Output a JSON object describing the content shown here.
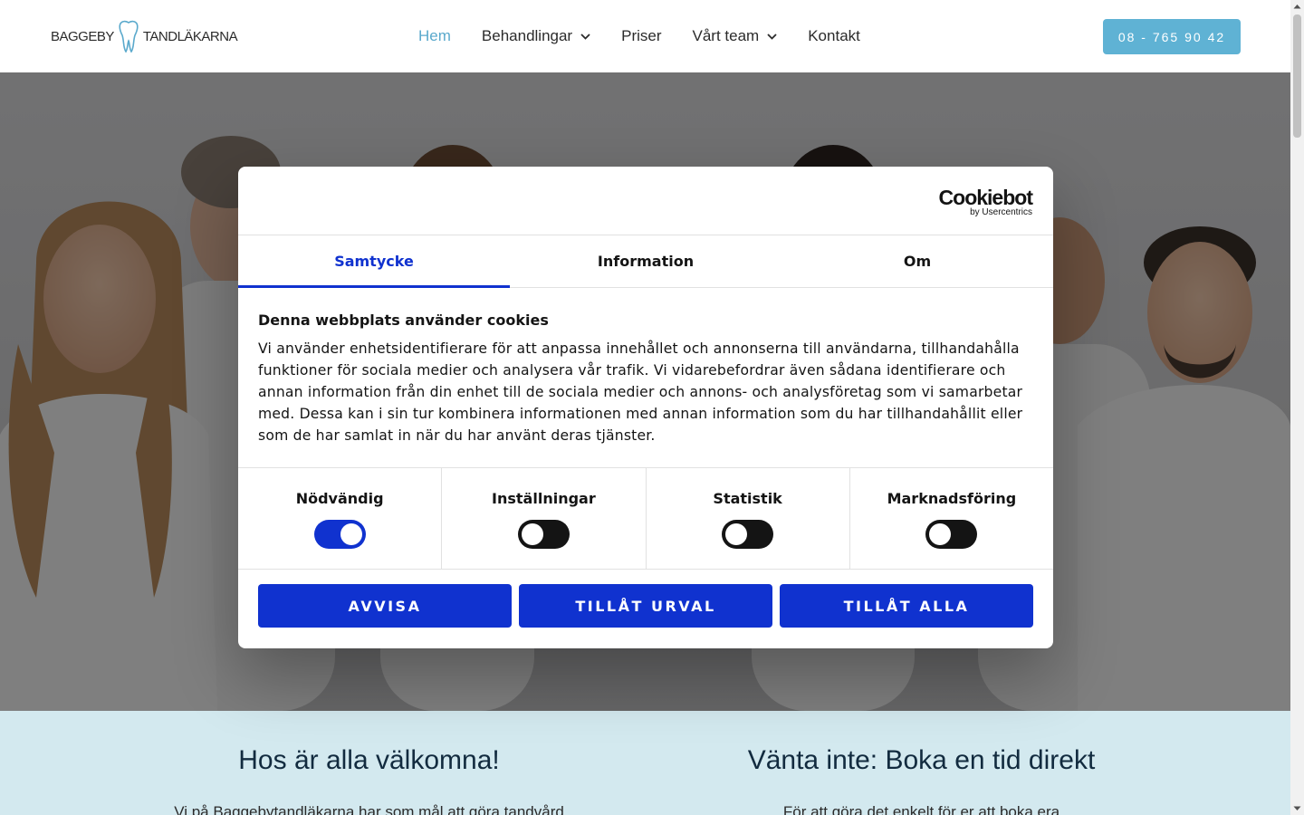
{
  "header": {
    "logo_left": "BAGGEBY",
    "logo_right": "TANDLÄKARNA",
    "nav": [
      {
        "label": "Hem",
        "active": true,
        "dropdown": false
      },
      {
        "label": "Behandlingar",
        "active": false,
        "dropdown": true
      },
      {
        "label": "Priser",
        "active": false,
        "dropdown": false
      },
      {
        "label": "Vårt team",
        "active": false,
        "dropdown": true
      },
      {
        "label": "Kontakt",
        "active": false,
        "dropdown": false
      }
    ],
    "phone": "08 - 765 90 42"
  },
  "sections": {
    "left_title": "Hos är alla välkomna!",
    "left_text": "Vi på Baggebytandläkarna har som mål att göra tandvård",
    "right_title": "Vänta inte: Boka en tid direkt",
    "right_text": "För att göra det enkelt för er att boka era"
  },
  "cookie_dialog": {
    "brand": "Cookiebot",
    "brand_sub": "by Usercentrics",
    "tabs": [
      {
        "label": "Samtycke",
        "active": true
      },
      {
        "label": "Information",
        "active": false
      },
      {
        "label": "Om",
        "active": false
      }
    ],
    "title": "Denna webbplats använder cookies",
    "text": "Vi använder enhetsidentifierare för att anpassa innehållet och annonserna till användarna, tillhandahålla funktioner för sociala medier och analysera vår trafik. Vi vidarebefordrar även sådana identifierare och annan information från din enhet till de sociala medier och annons- och analysföretag som vi samarbetar med. Dessa kan i sin tur kombinera informationen med annan information som du har tillhandahållit eller som de har samlat in när du har använt deras tjänster.",
    "toggles": [
      {
        "label": "Nödvändig",
        "on": true
      },
      {
        "label": "Inställningar",
        "on": false
      },
      {
        "label": "Statistik",
        "on": false
      },
      {
        "label": "Marknadsföring",
        "on": false
      }
    ],
    "buttons": {
      "reject": "AVVISA",
      "allow_selection": "TILLÅT URVAL",
      "allow_all": "TILLÅT ALLA"
    }
  },
  "colors": {
    "accent_nav": "#5aa9cc",
    "phone_button": "#5fb2d4",
    "cookie_primary": "#1032cf",
    "section_bg": "#d3e9ef"
  }
}
